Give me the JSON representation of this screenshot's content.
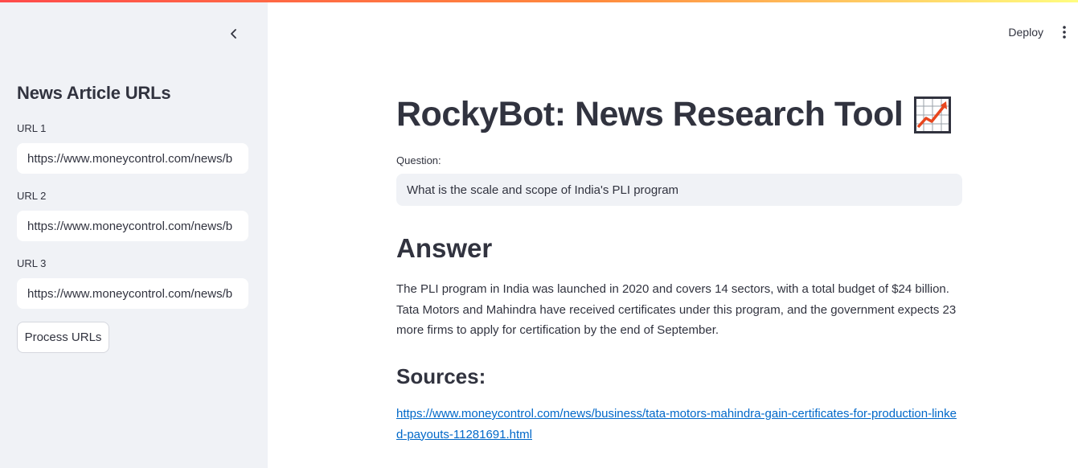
{
  "sidebar": {
    "title": "News Article URLs",
    "urls": [
      {
        "label": "URL 1",
        "value": "https://www.moneycontrol.com/news/b"
      },
      {
        "label": "URL 2",
        "value": "https://www.moneycontrol.com/news/b"
      },
      {
        "label": "URL 3",
        "value": "https://www.moneycontrol.com/news/b"
      }
    ],
    "process_button": "Process URLs"
  },
  "header": {
    "deploy_label": "Deploy"
  },
  "main": {
    "title": "RockyBot: News Research Tool",
    "title_emoji": "chart-increasing-icon",
    "question_label": "Question:",
    "question_value": "What is the scale and scope of India's PLI program",
    "answer_heading": "Answer",
    "answer_text": "The PLI program in India was launched in 2020 and covers 14 sectors, with a total budget of $24 billion. Tata Motors and Mahindra have received certificates under this program, and the government expects 23 more firms to apply for certification by the end of September.",
    "sources_heading": "Sources:",
    "source_link": "https://www.moneycontrol.com/news/business/tata-motors-mahindra-gain-certificates-for-production-linked-payouts-11281691.html"
  },
  "colors": {
    "sidebar_bg": "#f0f2f6",
    "text": "#31333f",
    "link": "#0068c9",
    "accent_gradient_start": "#ff4b4b",
    "accent_gradient_end": "#fffd80"
  }
}
